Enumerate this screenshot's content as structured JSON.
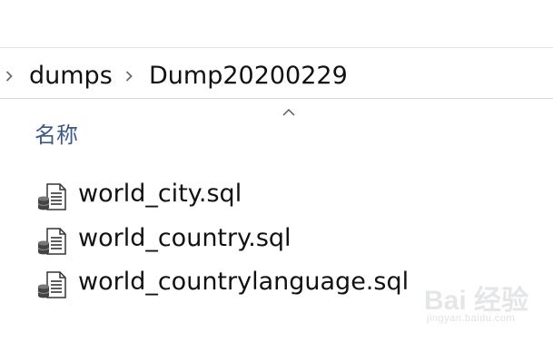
{
  "breadcrumb": {
    "items": [
      {
        "label": "dumps"
      },
      {
        "label": "Dump20200229"
      }
    ]
  },
  "file_list": {
    "column_header": "名称",
    "files": [
      {
        "name": "world_city.sql",
        "icon": "sql-file-icon"
      },
      {
        "name": "world_country.sql",
        "icon": "sql-file-icon"
      },
      {
        "name": "world_countrylanguage.sql",
        "icon": "sql-file-icon"
      }
    ]
  },
  "watermark": {
    "text": "Bai 经验",
    "sub": "jingyan.baidu.com"
  },
  "colors": {
    "header_text": "#3d5a86",
    "chevron": "#6b6b6b",
    "divider": "#d9d9d9"
  }
}
